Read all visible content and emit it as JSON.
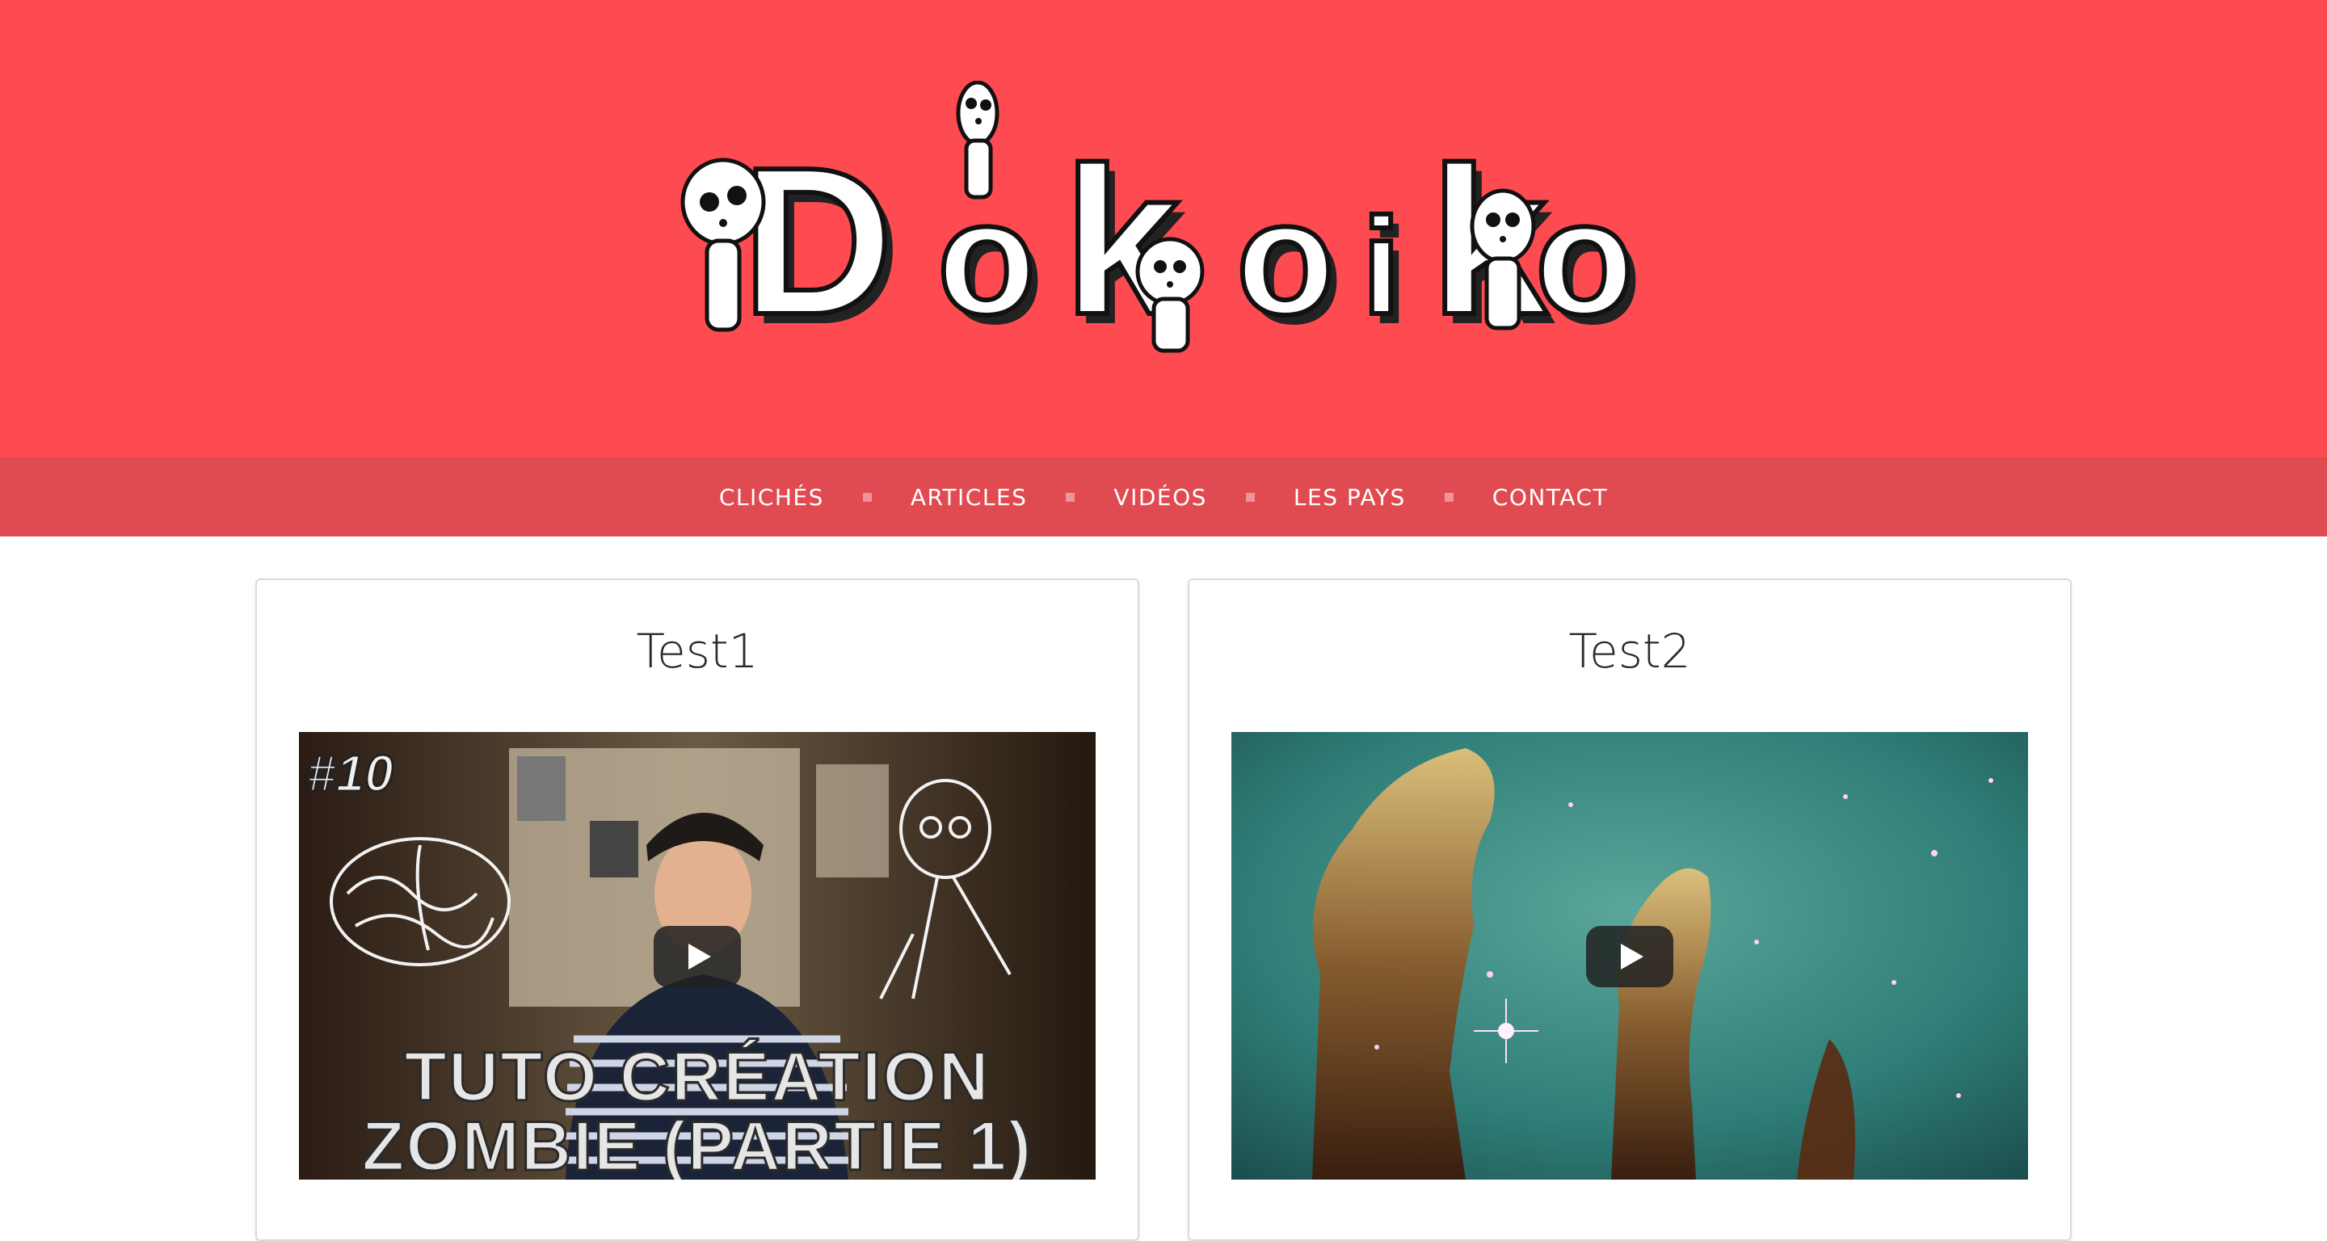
{
  "header": {
    "logo_text": "Dokoiko",
    "background_color": "#fe4b51",
    "nav_background_color": "#e04b52"
  },
  "nav": {
    "items": [
      {
        "label": "CLICHÉS"
      },
      {
        "label": "ARTICLES"
      },
      {
        "label": "VIDÉOS"
      },
      {
        "label": "LES PAYS"
      },
      {
        "label": "CONTACT"
      }
    ]
  },
  "cards": [
    {
      "title": "Test1",
      "video": {
        "badge": "#10",
        "line1": "TUTO CRÉATION",
        "line2": "ZOMBIE (PARTIE 1)",
        "play_icon": "play-icon"
      }
    },
    {
      "title": "Test2",
      "video": {
        "play_icon": "play-icon"
      }
    }
  ]
}
